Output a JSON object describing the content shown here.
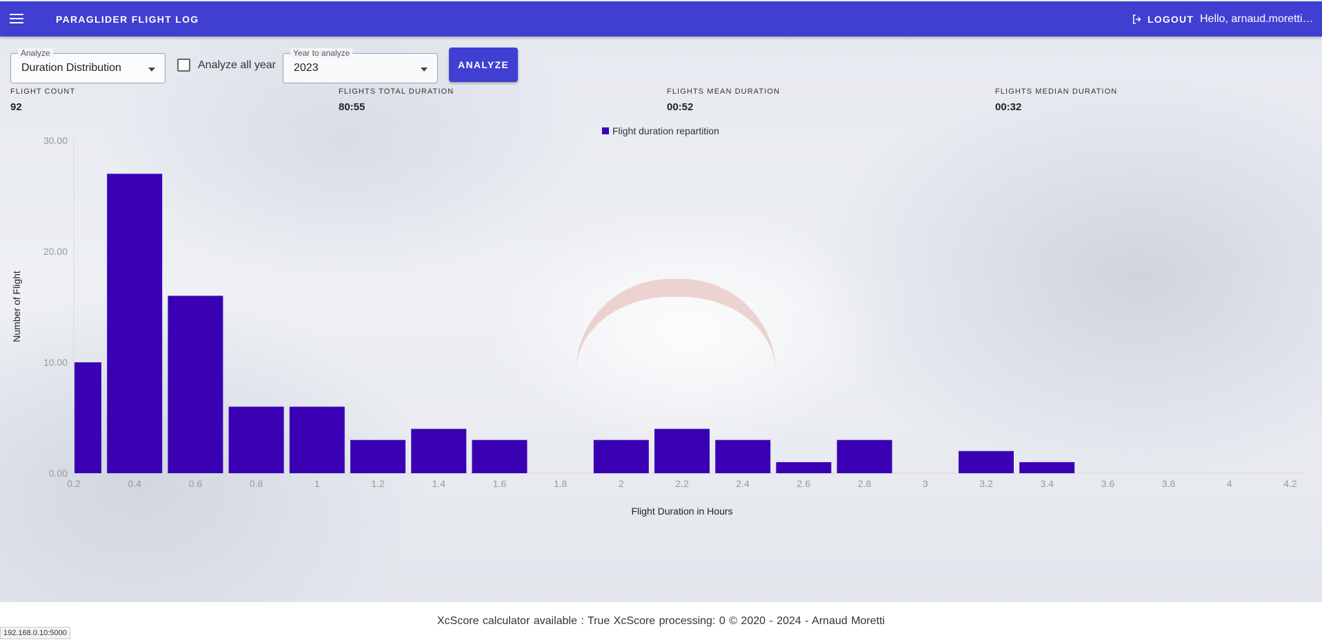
{
  "app": {
    "title": "PARAGLIDER FLIGHT LOG",
    "logout": "LOGOUT",
    "greeting": "Hello, arnaud.moretti@..."
  },
  "controls": {
    "analyze_legend": "Analyze",
    "analyze_value": "Duration Distribution",
    "all_year_label": "Analyze all year",
    "all_year_checked": false,
    "year_legend": "Year to analyze",
    "year_value": "2023",
    "analyze_button": "ANALYZE"
  },
  "stats": [
    {
      "label": "FLIGHT COUNT",
      "value": "92"
    },
    {
      "label": "FLIGHTS TOTAL DURATION",
      "value": "80:55"
    },
    {
      "label": "FLIGHTS MEAN DURATION",
      "value": "00:52"
    },
    {
      "label": "FLIGHTS MEDIAN DURATION",
      "value": "00:32"
    }
  ],
  "chart_data": {
    "type": "bar",
    "legend": "Flight duration repartition",
    "legend_placement": "top-center",
    "xlabel": "Flight Duration in Hours",
    "ylabel": "Number of Flight",
    "ylim": [
      0,
      30
    ],
    "yticks": [
      "0.00",
      "10.00",
      "20.00",
      "30.00"
    ],
    "xticks": [
      "0.2",
      "0.4",
      "0.6",
      "0.8",
      "1",
      "1.2",
      "1.4",
      "1.6",
      "1.8",
      "2",
      "2.2",
      "2.4",
      "2.6",
      "2.8",
      "3",
      "3.2",
      "3.4",
      "3.6",
      "3.8",
      "4",
      "4.2"
    ],
    "series": [
      {
        "name": "Flight duration repartition",
        "color": "#3a00b4",
        "x": [
          0.2,
          0.4,
          0.6,
          0.8,
          1.0,
          1.2,
          1.4,
          1.6,
          1.8,
          2.0,
          2.2,
          2.4,
          2.6,
          2.8,
          3.0,
          3.2,
          3.4,
          3.6,
          3.8,
          4.0,
          4.2
        ],
        "values": [
          10,
          27,
          16,
          6,
          6,
          3,
          4,
          3,
          0,
          3,
          4,
          3,
          1,
          3,
          0,
          2,
          1,
          0,
          0,
          0,
          0
        ]
      }
    ],
    "grid": false
  },
  "footer": {
    "text": "XcScore calculator available : True   XcScore processing: 0   © 2020 - 2024 - Arnaud Moretti",
    "status_url": "192.168.0.10:5000"
  },
  "colors": {
    "accent": "#3f3fd1",
    "bar": "#3a00b4"
  }
}
